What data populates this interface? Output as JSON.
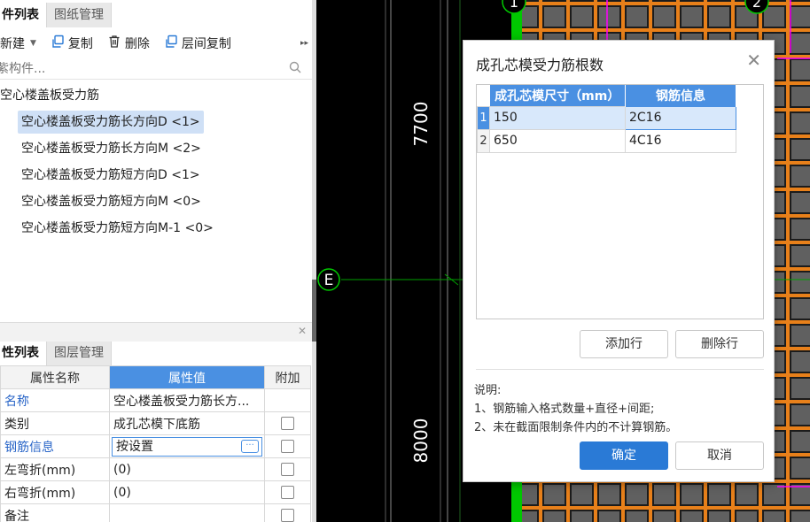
{
  "left_panel": {
    "top_tabs": [
      {
        "label": "件列表",
        "active": true
      },
      {
        "label": "图纸管理",
        "active": false
      }
    ],
    "toolbar": {
      "new_label": "新建",
      "copy_label": "复制",
      "delete_label": "删除",
      "floor_copy_label": "层间复制",
      "more_glyph": "▸▸"
    },
    "search": {
      "placeholder": "紫构件..."
    },
    "tree": {
      "root": "空心楼盖板受力筋",
      "children": [
        {
          "label": "空心楼盖板受力筋长方向D <1>",
          "selected": true
        },
        {
          "label": "空心楼盖板受力筋长方向M <2>",
          "selected": false
        },
        {
          "label": "空心楼盖板受力筋短方向D <1>",
          "selected": false
        },
        {
          "label": "空心楼盖板受力筋短方向M <0>",
          "selected": false
        },
        {
          "label": "空心楼盖板受力筋短方向M-1 <0>",
          "selected": false
        }
      ]
    },
    "bottom_tabs": [
      {
        "label": "性列表",
        "active": true
      },
      {
        "label": "图层管理",
        "active": false
      }
    ],
    "properties": {
      "headers": [
        "属性名称",
        "属性值",
        "附加"
      ],
      "rows": [
        {
          "name": "名称",
          "value": "空心楼盖板受力筋长方...",
          "checkbox": false,
          "highlight": true
        },
        {
          "name": "类别",
          "value": "成孔芯模下底筋",
          "checkbox": true,
          "highlight": false
        },
        {
          "name": "钢筋信息",
          "value": "按设置",
          "checkbox": true,
          "highlight": true
        },
        {
          "name": "左弯折(mm)",
          "value": "(0)",
          "checkbox": true,
          "highlight": false
        },
        {
          "name": "右弯折(mm)",
          "value": "(0)",
          "checkbox": true,
          "highlight": false
        },
        {
          "name": "备注",
          "value": "",
          "checkbox": true,
          "highlight": false
        }
      ],
      "ellipsis_button": "···"
    }
  },
  "cad": {
    "dim_top": "7700",
    "dim_bottom": "8000",
    "axis_e": "E",
    "axis_1": "1",
    "axis_2": "2",
    "colors": {
      "background": "#000000",
      "axis_green": "#00c800",
      "rebar_orange": "#e8801a",
      "slab_gray": "#606060",
      "magenta": "#ff00ff"
    }
  },
  "dialog": {
    "title": "成孔芯模受力筋根数",
    "close_glyph": "✕",
    "table": {
      "headers": [
        "成孔芯模尺寸（mm）",
        "钢筋信息"
      ],
      "rows": [
        {
          "num": "1",
          "size": "150",
          "rebar": "2C16",
          "selected": true
        },
        {
          "num": "2",
          "size": "650",
          "rebar": "4C16",
          "selected": false
        }
      ]
    },
    "add_row_label": "添加行",
    "delete_row_label": "删除行",
    "notes": [
      "说明:",
      "1、钢筋输入格式数量+直径+间距;",
      "2、未在截面限制条件内的不计算钢筋。"
    ],
    "ok_label": "确定",
    "cancel_label": "取消"
  }
}
